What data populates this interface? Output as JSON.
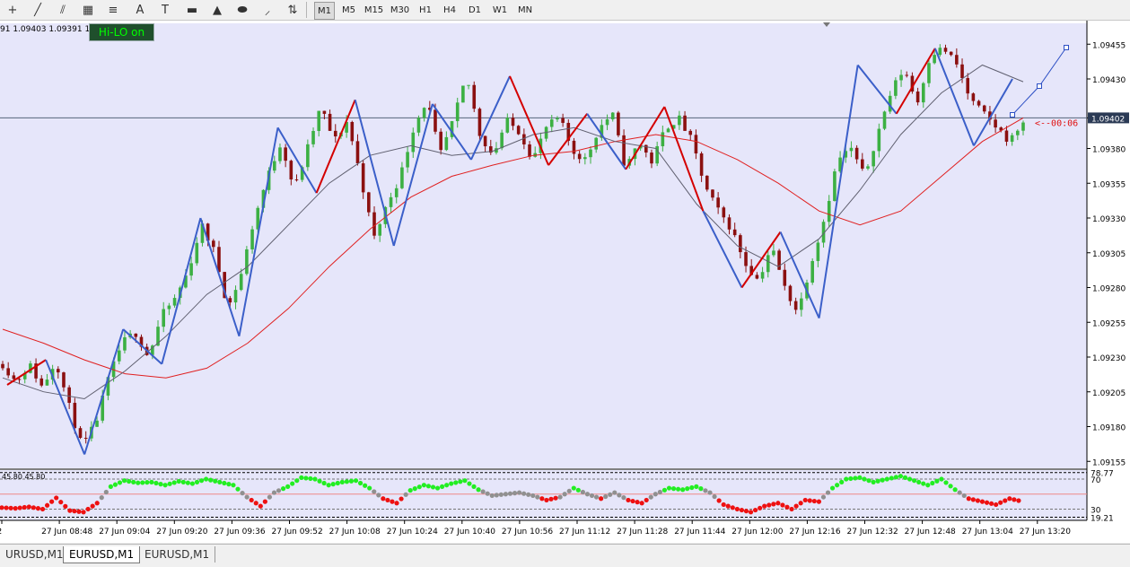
{
  "toolbar": {
    "tools": [
      {
        "name": "crosshair-tool-icon",
        "glyph": "+"
      },
      {
        "name": "trendline-tool-icon",
        "glyph": "╱"
      },
      {
        "name": "channel-tool-icon",
        "glyph": "⫽"
      },
      {
        "name": "gann-tool-icon",
        "glyph": "▦"
      },
      {
        "name": "fibo-tool-icon",
        "glyph": "≡"
      },
      {
        "name": "text-tool-icon",
        "glyph": "A"
      },
      {
        "name": "text-label-tool-icon",
        "glyph": "T"
      },
      {
        "name": "rectangle-tool-icon",
        "glyph": "▬"
      },
      {
        "name": "triangle-tool-icon",
        "glyph": "▲"
      },
      {
        "name": "ellipse-tool-icon",
        "glyph": "⬬"
      },
      {
        "name": "fibo-fan-tool-icon",
        "glyph": "⸝"
      },
      {
        "name": "arrows-tool-icon",
        "glyph": "⇅"
      }
    ],
    "timeframes": [
      "M1",
      "M5",
      "M15",
      "M30",
      "H1",
      "H4",
      "D1",
      "W1",
      "MN"
    ],
    "active_timeframe": "M1"
  },
  "ohlc_text": "91 1.09403 1.09391 1.09",
  "hilo_button": "Hi-LO on",
  "chart_data": {
    "type": "candlestick",
    "symbol": "EURUSD",
    "timeframe": "M1",
    "price_axis_ticks": [
      "1.09455",
      "1.09430",
      "1.09402",
      "1.09380",
      "1.09355",
      "1.09330",
      "1.09305",
      "1.09280",
      "1.09255",
      "1.09230",
      "1.09205",
      "1.09180",
      "1.09155"
    ],
    "price_axis_values": [
      1.09455,
      1.0943,
      1.09402,
      1.0938,
      1.09355,
      1.0933,
      1.09305,
      1.0928,
      1.09255,
      1.0923,
      1.09205,
      1.0918,
      1.09155
    ],
    "current_price": "1.09402",
    "countdown_label": "<--00:06",
    "ylim": [
      1.0915,
      1.0947
    ],
    "time_axis_labels": [
      "8:32",
      "27 Jun 08:48",
      "27 Jun 09:04",
      "27 Jun 09:20",
      "27 Jun 09:36",
      "27 Jun 09:52",
      "27 Jun 10:08",
      "27 Jun 10:24",
      "27 Jun 10:40",
      "27 Jun 10:56",
      "27 Jun 11:12",
      "27 Jun 11:28",
      "27 Jun 11:44",
      "27 Jun 12:00",
      "27 Jun 12:16",
      "27 Jun 12:32",
      "27 Jun 12:48",
      "27 Jun 13:04",
      "27 Jun 13:20"
    ],
    "price_path": [
      1.09225,
      1.09212,
      1.09225,
      1.09208,
      1.09228,
      1.09195,
      1.09165,
      1.09182,
      1.09215,
      1.0924,
      1.09248,
      1.0923,
      1.0926,
      1.09272,
      1.09292,
      1.09325,
      1.09305,
      1.09265,
      1.0929,
      1.0933,
      1.0936,
      1.09385,
      1.0935,
      1.0938,
      1.0941,
      1.09385,
      1.094,
      1.0936,
      1.09315,
      1.0934,
      1.0936,
      1.09395,
      1.09415,
      1.09375,
      1.094,
      1.09432,
      1.0939,
      1.09375,
      1.094,
      1.09392,
      1.09372,
      1.09395,
      1.09402,
      1.09378,
      1.09372,
      1.09395,
      1.09405,
      1.09365,
      1.09385,
      1.0937,
      1.09395,
      1.09402,
      1.09385,
      1.09352,
      1.09335,
      1.09322,
      1.09298,
      1.09285,
      1.0931,
      1.0928,
      1.09262,
      1.09298,
      1.0933,
      1.09372,
      1.0938,
      1.0936,
      1.0939,
      1.0942,
      1.09438,
      1.09412,
      1.09448,
      1.09452,
      1.0944,
      1.09415,
      1.09405,
      1.09395,
      1.09385,
      1.094
    ],
    "zigzag_points": [
      [
        1.0921,
        "red"
      ],
      [
        1.09228,
        "red"
      ],
      [
        1.0916,
        "blue"
      ],
      [
        1.0925,
        "blue"
      ],
      [
        1.09225,
        "blue"
      ],
      [
        1.0933,
        "blue"
      ],
      [
        1.09245,
        "blue"
      ],
      [
        1.09395,
        "blue"
      ],
      [
        1.09348,
        "blue"
      ],
      [
        1.09415,
        "red"
      ],
      [
        1.0931,
        "blue"
      ],
      [
        1.09412,
        "blue"
      ],
      [
        1.09372,
        "blue"
      ],
      [
        1.09432,
        "blue"
      ],
      [
        1.09368,
        "red"
      ],
      [
        1.09405,
        "red"
      ],
      [
        1.09365,
        "blue"
      ],
      [
        1.0941,
        "red"
      ],
      [
        1.09335,
        "red"
      ],
      [
        1.0928,
        "blue"
      ],
      [
        1.0932,
        "red"
      ],
      [
        1.09258,
        "blue"
      ],
      [
        1.0944,
        "blue"
      ],
      [
        1.09405,
        "blue"
      ],
      [
        1.09452,
        "red"
      ],
      [
        1.09382,
        "blue"
      ],
      [
        1.0943,
        "blue"
      ]
    ],
    "ma_slow": [
      1.0925,
      1.0924,
      1.09228,
      1.09218,
      1.09215,
      1.09222,
      1.0924,
      1.09265,
      1.09295,
      1.09322,
      1.09345,
      1.0936,
      1.09368,
      1.09375,
      1.09378,
      1.09385,
      1.0939,
      1.09385,
      1.09372,
      1.09355,
      1.09335,
      1.09325,
      1.09335,
      1.0936,
      1.09385,
      1.09402
    ],
    "ma_fast": [
      1.09215,
      1.09205,
      1.092,
      1.0922,
      1.09245,
      1.09275,
      1.09295,
      1.09325,
      1.09355,
      1.09375,
      1.09382,
      1.09375,
      1.09378,
      1.0939,
      1.09395,
      1.09385,
      1.0938,
      1.0934,
      1.0931,
      1.09295,
      1.09315,
      1.0935,
      1.0939,
      1.0942,
      1.0944,
      1.09428
    ],
    "oscillator": {
      "label": "45.80 45.80",
      "levels": [
        "78.77",
        "70",
        "30",
        "19.21"
      ],
      "level_values": [
        78.77,
        70,
        30,
        19.21
      ],
      "ylim": [
        15,
        82
      ],
      "values": [
        32,
        31,
        33,
        30,
        45,
        28,
        26,
        38,
        60,
        68,
        65,
        66,
        62,
        67,
        64,
        70,
        66,
        62,
        46,
        34,
        52,
        60,
        72,
        70,
        62,
        66,
        68,
        58,
        44,
        38,
        55,
        62,
        58,
        64,
        68,
        56,
        48,
        50,
        52,
        48,
        42,
        46,
        58,
        50,
        44,
        52,
        42,
        38,
        50,
        58,
        56,
        60,
        52,
        36,
        30,
        26,
        34,
        38,
        30,
        42,
        40,
        58,
        70,
        72,
        66,
        70,
        74,
        68,
        62,
        70,
        56,
        44,
        40,
        36,
        44,
        40
      ]
    }
  },
  "colors": {
    "plot_bg": "#e6e6fa",
    "bull": "#3cb043",
    "bear": "#8b1010",
    "zigzag_blue": "#3b5fc9",
    "zigzag_red": "#d40000",
    "ma_slow": "#e02020",
    "ma_fast": "#606070",
    "osc_green": "#22ee22",
    "osc_red": "#ee1111",
    "osc_gray": "#909090"
  },
  "tabs": [
    "URUSD,M1",
    "EURUSD,M1",
    "EURUSD,M1"
  ],
  "active_tab": 1
}
